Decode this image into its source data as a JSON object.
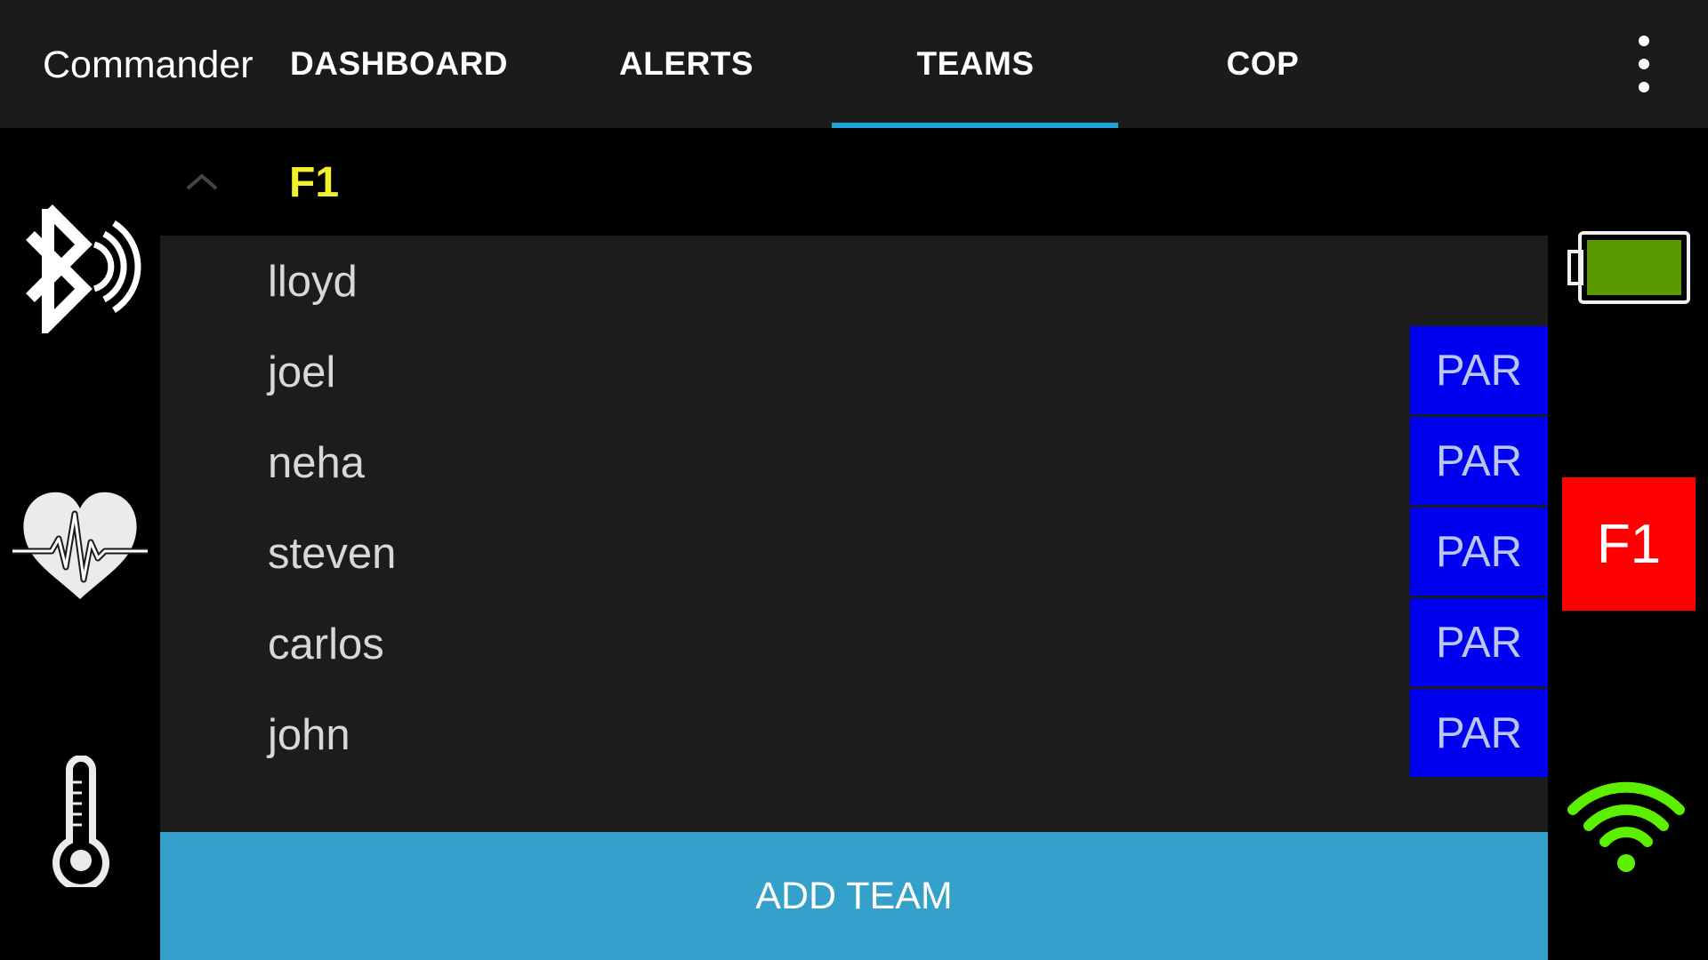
{
  "app": {
    "title": "Commander"
  },
  "tabs": [
    {
      "label": "DASHBOARD"
    },
    {
      "label": "ALERTS"
    },
    {
      "label": "TEAMS",
      "selected": true
    },
    {
      "label": "COP"
    }
  ],
  "team": {
    "name": "F1",
    "badge": "F1",
    "badge_color": "#ff0000",
    "members": [
      {
        "name": "lloyd",
        "par_label": ""
      },
      {
        "name": "joel",
        "par_label": "PAR"
      },
      {
        "name": "neha",
        "par_label": "PAR"
      },
      {
        "name": "steven",
        "par_label": "PAR"
      },
      {
        "name": "carlos",
        "par_label": "PAR"
      },
      {
        "name": "john",
        "par_label": "PAR"
      }
    ]
  },
  "actions": {
    "add_team_label": "ADD TEAM"
  },
  "status": {
    "battery_color": "#5a9a00",
    "wifi_color": "#5cf000",
    "icons": [
      "bluetooth-icon",
      "heart-rate-icon",
      "thermometer-icon",
      "battery-icon",
      "wifi-icon"
    ]
  },
  "colors": {
    "accent": "#1fa3d6",
    "team_name": "#f2ef2d",
    "par_button": "#0000f0",
    "add_team": "#35a0c9"
  }
}
